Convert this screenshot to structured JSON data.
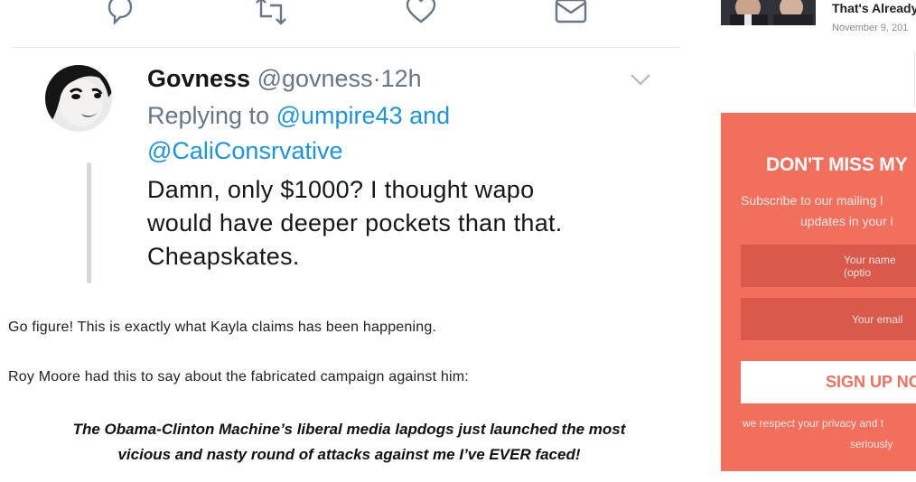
{
  "tweet": {
    "author_name": "Govness",
    "author_handle": "@govness",
    "separator": "·",
    "time": "12h",
    "replying_prefix": "Replying to",
    "reply_handle_1": "@umpire43",
    "reply_and": "and",
    "reply_handle_2": "@CaliConsrvative",
    "text_line_1": "Damn, only $1000? I thought wapo",
    "text_line_2": "would have deeper pockets than that.",
    "text_line_3": "Cheapskates.",
    "actions": [
      "reply-icon",
      "retweet-icon",
      "like-icon",
      "dm-icon"
    ]
  },
  "article": {
    "paragraph_1": "Go figure! This is exactly what Kayla claims has been happening.",
    "paragraph_2": "Roy Moore had this to say about the fabricated campaign against him:",
    "quote_line_1": "The Obama-Clinton Machine’s liberal media lapdogs just launched the most",
    "quote_line_2": "vicious and nasty round of attacks against me I’ve EVER faced!"
  },
  "sidebar": {
    "related_title": "That's Already",
    "related_date": "November 9, 201",
    "optin": {
      "title": "DON'T MISS MY",
      "subtitle_1": "Subscribe to our mailing l",
      "subtitle_2": "updates in your i",
      "name_placeholder": "Your name (optio",
      "email_placeholder": "Your email",
      "button_label": "SIGN UP NO",
      "privacy_1": "we respect your privacy and t",
      "privacy_2": "seriously",
      "accent_color": "#f36f5d"
    }
  }
}
